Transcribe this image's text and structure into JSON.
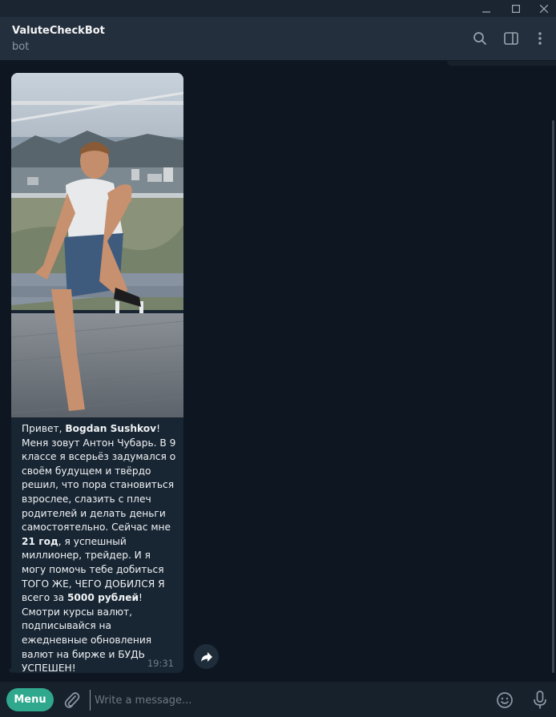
{
  "window": {
    "minimize_glyph": "—",
    "maximize_glyph": "☐",
    "close_glyph": "✕"
  },
  "header": {
    "title": "ValuteCheckBot",
    "status": "bot",
    "icons": [
      "search-icon",
      "sidebar-toggle-icon",
      "more-vertical-icon"
    ]
  },
  "message": {
    "greeting_prefix": "Привет, ",
    "user_name": "Bogdan Sushkov",
    "line_after_name": "! Меня зовут Антон Чубарь. В 9 классе я всерьёз задумался о своём будущем и твёрдо решил, что пора становиться взрослее, слазить с плеч родителей и делать деньги самостоятельно. Сейчас мне ",
    "age": "21 год",
    "middle_text": ", я успешный миллионер, трейдер. И я могу помочь тебе добиться ТОГО ЖЕ, ЧЕГО ДОБИЛСЯ Я всего за ",
    "amount": "5000 рублей",
    "end_text": "! Смотри курсы валют, подписывайся на ежедневные обновления валют на бирже и БУДЬ УСПЕШЕН!",
    "time": "19:31",
    "photo_icon": "photo-person-on-balcony"
  },
  "composer": {
    "menu_label": "Menu",
    "placeholder": "Write a message...",
    "icons": [
      "attach-icon",
      "emoji-icon",
      "microphone-icon"
    ]
  },
  "colors": {
    "background": "#0e1621",
    "header": "#242f3d",
    "bubble": "#182533",
    "accent": "#2fa88d"
  }
}
